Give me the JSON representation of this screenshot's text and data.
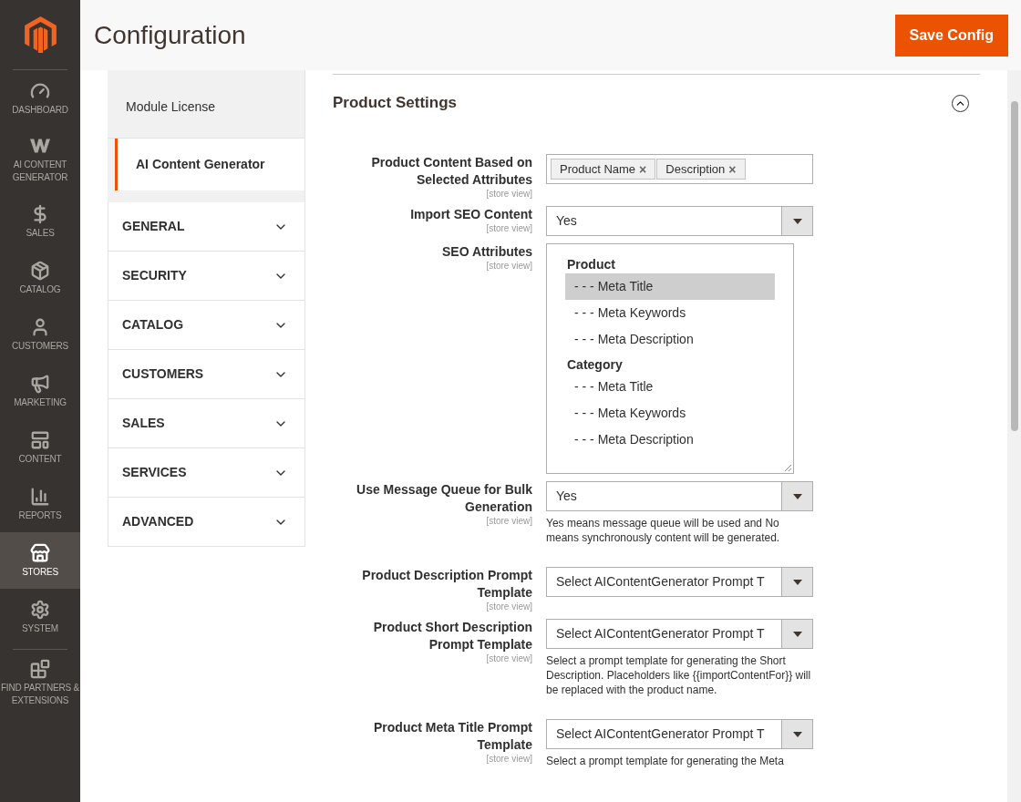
{
  "nav": [
    {
      "label": "DASHBOARD",
      "selected": false
    },
    {
      "label": "AI CONTENT GENERATOR",
      "selected": false
    },
    {
      "label": "SALES",
      "selected": false
    },
    {
      "label": "CATALOG",
      "selected": false
    },
    {
      "label": "CUSTOMERS",
      "selected": false
    },
    {
      "label": "MARKETING",
      "selected": false
    },
    {
      "label": "CONTENT",
      "selected": false
    },
    {
      "label": "REPORTS",
      "selected": false
    },
    {
      "label": "STORES",
      "selected": true
    },
    {
      "label": "SYSTEM",
      "selected": false
    },
    {
      "label": "FIND PARTNERS & EXTENSIONS",
      "selected": false
    }
  ],
  "header": {
    "title": "Configuration",
    "save_button": "Save Config"
  },
  "tabs": [
    {
      "label": "Module License",
      "selected": false
    },
    {
      "label": "AI Content Generator",
      "selected": true
    }
  ],
  "sections": [
    {
      "label": "GENERAL",
      "expanded": false
    },
    {
      "label": "SECURITY",
      "expanded": false
    },
    {
      "label": "CATALOG",
      "expanded": false
    },
    {
      "label": "CUSTOMERS",
      "expanded": false
    },
    {
      "label": "SALES",
      "expanded": false
    },
    {
      "label": "SERVICES",
      "expanded": false
    },
    {
      "label": "ADVANCED",
      "expanded": false
    }
  ],
  "group": {
    "title": "Product Settings",
    "expanded": true,
    "fields": [
      {
        "kind": "tags",
        "label": "Product Content Based on Selected Attributes",
        "scope": "[store view]",
        "tags": [
          "Product Name",
          "Description"
        ],
        "remove": "×"
      },
      {
        "kind": "select",
        "label": "Import SEO Content",
        "scope": "[store view]",
        "value": "Yes"
      },
      {
        "kind": "listbox",
        "label": "SEO Attributes",
        "scope": "[store view]",
        "groups": [
          {
            "label": "Product",
            "options": [
              {
                "label": "- - - Meta Title",
                "selected": true
              },
              {
                "label": "- - - Meta Keywords",
                "selected": false
              },
              {
                "label": "- - - Meta Description",
                "selected": false
              }
            ]
          },
          {
            "label": "Category",
            "options": [
              {
                "label": "- - - Meta Title",
                "selected": false
              },
              {
                "label": "- - - Meta Keywords",
                "selected": false
              },
              {
                "label": "- - - Meta Description",
                "selected": false
              }
            ]
          }
        ]
      },
      {
        "kind": "select",
        "label": "Use Message Queue for Bulk Generation",
        "scope": "[store view]",
        "value": "Yes",
        "note": "Yes means message queue will be used and No means synchronously content will be generated."
      },
      {
        "kind": "select",
        "label": "Product Description Prompt Template",
        "scope": "[store view]",
        "value": "Select AIContentGenerator Prompt T"
      },
      {
        "kind": "select",
        "label": "Product Short Description Prompt Template",
        "scope": "[store view]",
        "value": "Select AIContentGenerator Prompt T",
        "note": "Select a prompt template for generating the Short Description. Placeholders like {{importContentFor}} will be replaced with the product name."
      },
      {
        "kind": "select",
        "label": "Product Meta Title Prompt Template",
        "scope": "[store view]",
        "value": "Select AIContentGenerator Prompt T",
        "note": "Select a prompt template for generating the Meta"
      }
    ]
  }
}
